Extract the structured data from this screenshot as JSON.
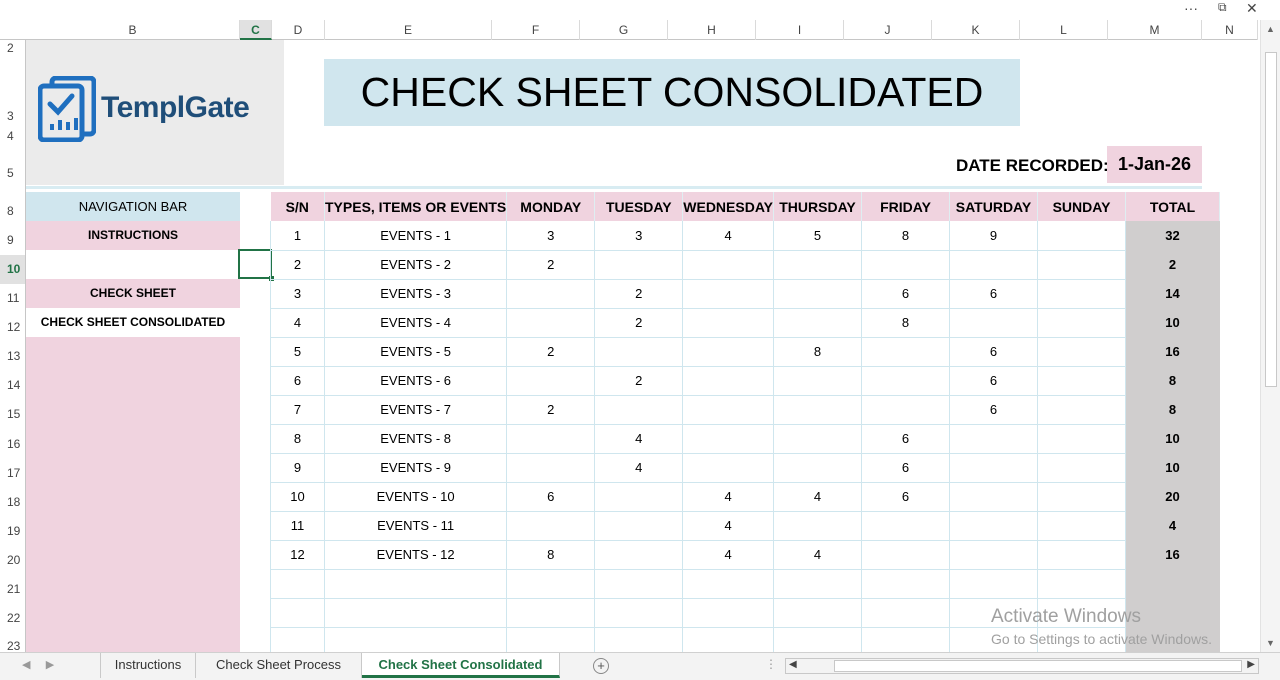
{
  "window": {
    "more": "···",
    "restore": "⧉",
    "close": "✕"
  },
  "columns": [
    "B",
    "C",
    "D",
    "E",
    "F",
    "G",
    "H",
    "I",
    "J",
    "K",
    "L",
    "M",
    "N"
  ],
  "rows": [
    "2",
    "3",
    "4",
    "5",
    "8",
    "9",
    "10",
    "11",
    "12",
    "13",
    "14",
    "15",
    "16",
    "17",
    "18",
    "19",
    "20",
    "21",
    "22",
    "23"
  ],
  "logo": {
    "text": "TemplGate"
  },
  "title": "CHECK SHEET CONSOLIDATED",
  "date": {
    "label": "DATE RECORDED:",
    "value": "1-Jan-26"
  },
  "nav": {
    "header": "NAVIGATION BAR",
    "items": [
      "INSTRUCTIONS",
      "",
      "CHECK SHEET",
      "CHECK SHEET CONSOLIDATED"
    ]
  },
  "table": {
    "headers": [
      "S/N",
      "TYPES, ITEMS OR EVENTS",
      "MONDAY",
      "TUESDAY",
      "WEDNESDAY",
      "THURSDAY",
      "FRIDAY",
      "SATURDAY",
      "SUNDAY",
      "TOTAL"
    ],
    "rows": [
      [
        "1",
        "EVENTS - 1",
        "3",
        "3",
        "4",
        "5",
        "8",
        "9",
        "",
        "32"
      ],
      [
        "2",
        "EVENTS - 2",
        "2",
        "",
        "",
        "",
        "",
        "",
        "",
        "2"
      ],
      [
        "3",
        "EVENTS - 3",
        "",
        "2",
        "",
        "",
        "6",
        "6",
        "",
        "14"
      ],
      [
        "4",
        "EVENTS - 4",
        "",
        "2",
        "",
        "",
        "8",
        "",
        "",
        "10"
      ],
      [
        "5",
        "EVENTS - 5",
        "2",
        "",
        "",
        "8",
        "",
        "6",
        "",
        "16"
      ],
      [
        "6",
        "EVENTS - 6",
        "",
        "2",
        "",
        "",
        "",
        "6",
        "",
        "8"
      ],
      [
        "7",
        "EVENTS - 7",
        "2",
        "",
        "",
        "",
        "",
        "6",
        "",
        "8"
      ],
      [
        "8",
        "EVENTS - 8",
        "",
        "4",
        "",
        "",
        "6",
        "",
        "",
        "10"
      ],
      [
        "9",
        "EVENTS - 9",
        "",
        "4",
        "",
        "",
        "6",
        "",
        "",
        "10"
      ],
      [
        "10",
        "EVENTS - 10",
        "6",
        "",
        "4",
        "4",
        "6",
        "",
        "",
        "20"
      ],
      [
        "11",
        "EVENTS - 11",
        "",
        "",
        "4",
        "",
        "",
        "",
        "",
        "4"
      ],
      [
        "12",
        "EVENTS - 12",
        "8",
        "",
        "4",
        "4",
        "",
        "",
        "",
        "16"
      ],
      [
        "",
        "",
        "",
        "",
        "",
        "",
        "",
        "",
        "",
        ""
      ],
      [
        "",
        "",
        "",
        "",
        "",
        "",
        "",
        "",
        "",
        ""
      ],
      [
        "",
        "",
        "",
        "",
        "",
        "",
        "",
        "",
        "",
        ""
      ]
    ]
  },
  "watermark": {
    "line1": "Activate Windows",
    "line2": "Go to Settings to activate Windows."
  },
  "tabs": [
    "Instructions",
    "Check Sheet Process",
    "Check Sheet Consolidated"
  ],
  "active_tab": "Check Sheet Consolidated",
  "add_sheet": "+",
  "colors": {
    "accent": "#217346",
    "title_bg": "#d0e6ee",
    "pink": "#f0d3df",
    "total_bg": "#d0cece",
    "logo_blue": "#1f4e79"
  }
}
